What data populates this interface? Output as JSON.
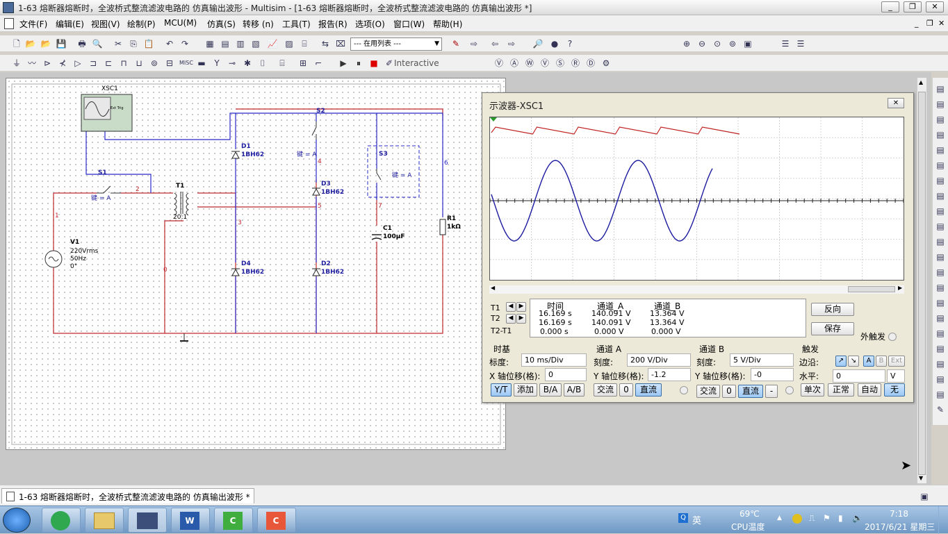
{
  "app": {
    "title": "1-63  熔断器熔断时，全波桥式整流滤波电路的 仿真输出波形 - Multisim - [1-63  熔断器熔断时，全波桥式整流滤波电路的 仿真输出波形 *]"
  },
  "menu": [
    "文件(F)",
    "编辑(E)",
    "视图(V)",
    "绘制(P)",
    "MCU(M)",
    "仿真(S)",
    "转移 (n)",
    "工具(T)",
    "报告(R)",
    "选项(O)",
    "窗口(W)",
    "帮助(H)"
  ],
  "toolbar": {
    "in_use_list": "--- 在用列表 ---",
    "interactive": "Interactive"
  },
  "circuit": {
    "xsc1": "XSC1",
    "s1": "S1",
    "s2": "S2",
    "s3": "S3",
    "key_a": "键 = A",
    "t1": "T1",
    "t1_ratio": "20:1",
    "v1": "V1",
    "v1_rms": "220Vrms",
    "v1_freq": "50Hz",
    "v1_phase": "0°",
    "d1": "D1",
    "d2": "D2",
    "d3": "D3",
    "d4": "D4",
    "diode_model": "1BH62",
    "c1": "C1",
    "c1_val": "100µF",
    "r1": "R1",
    "r1_val": "1kΩ",
    "n1": "1",
    "n2": "2",
    "n3": "3",
    "n4": "4",
    "n5": "5",
    "n6": "6",
    "n7": "7",
    "n0": "0",
    "scope_ext_trig": "Ext Trig"
  },
  "scope": {
    "title": "示波器-XSC1",
    "reverse": "反向",
    "save": "保存",
    "ext_trigger": "外触发",
    "cursor": {
      "t1": "T1",
      "t2": "T2",
      "t2t1": "T2-T1",
      "h_time": "时间",
      "h_cha": "通道_A",
      "h_chb": "通道_B",
      "rows": [
        [
          "16.169 s",
          "140.091 V",
          "13.364 V"
        ],
        [
          "16.169 s",
          "140.091 V",
          "13.364 V"
        ],
        [
          "0.000 s",
          "0.000 V",
          "0.000 V"
        ]
      ]
    },
    "timebase": {
      "label": "时基",
      "scale_label": "标度:",
      "scale": "10 ms/Div",
      "xpos_label": "X 轴位移(格):",
      "xpos": "0",
      "yt": "Y/T",
      "add": "添加",
      "ba": "B/A",
      "ab": "A/B"
    },
    "cha": {
      "label": "通道 A",
      "scale_label": "刻度:",
      "scale": "200  V/Div",
      "ypos_label": "Y 轴位移(格):",
      "ypos": "-1.2",
      "ac": "交流",
      "zero": "0",
      "dc": "直流"
    },
    "chb": {
      "label": "通道 B",
      "scale_label": "刻度:",
      "scale": "5  V/Div",
      "ypos_label": "Y 轴位移(格):",
      "ypos": "-0",
      "ac": "交流",
      "zero": "0",
      "dc": "直流",
      "minus": "-"
    },
    "trigger": {
      "label": "触发",
      "edge_label": "边沿:",
      "level_label": "水平:",
      "level": "0",
      "level_unit": "V",
      "a": "A",
      "b": "B",
      "ext": "Ext",
      "single": "单次",
      "normal": "正常",
      "auto": "自动",
      "none": "无"
    },
    "colors": {
      "cha": "#1a1aa0",
      "chb": "#c02020",
      "bg": "#ffffff"
    }
  },
  "status": {
    "doc_tab": "1-63  熔断器熔断时，全波桥式整流滤波电路的 仿真输出波形 *"
  },
  "taskbar": {
    "ime": "英",
    "temp": "69℃",
    "temp_label": "CPU温度",
    "time": "7:18",
    "date": "2017/6/21 星期三"
  }
}
